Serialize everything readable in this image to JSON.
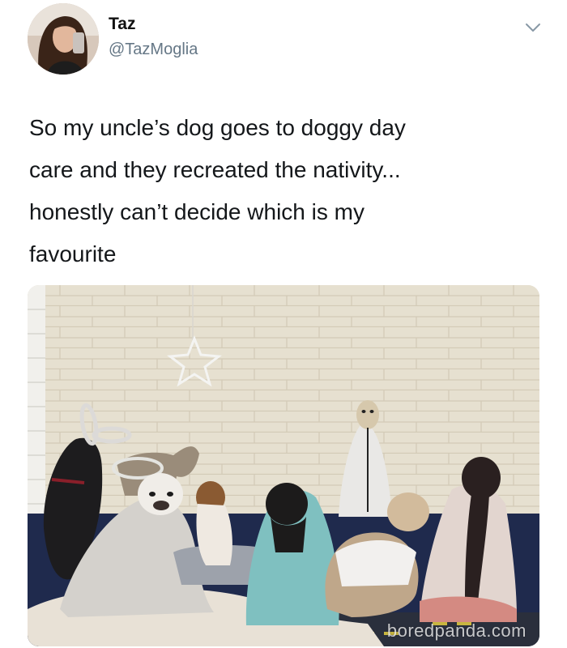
{
  "tweet": {
    "author_name": "Taz",
    "author_handle": "@TazMoglia",
    "text": "So my uncle’s dog goes to doggy day\ncare and they recreated the nativity...\nhonestly can’t decide which is my\nfavourite",
    "menu_icon": "chevron-down-icon"
  },
  "media": {
    "watermark": "boredpanda.com"
  },
  "colors": {
    "handle": "#657786",
    "text": "#14171a"
  }
}
